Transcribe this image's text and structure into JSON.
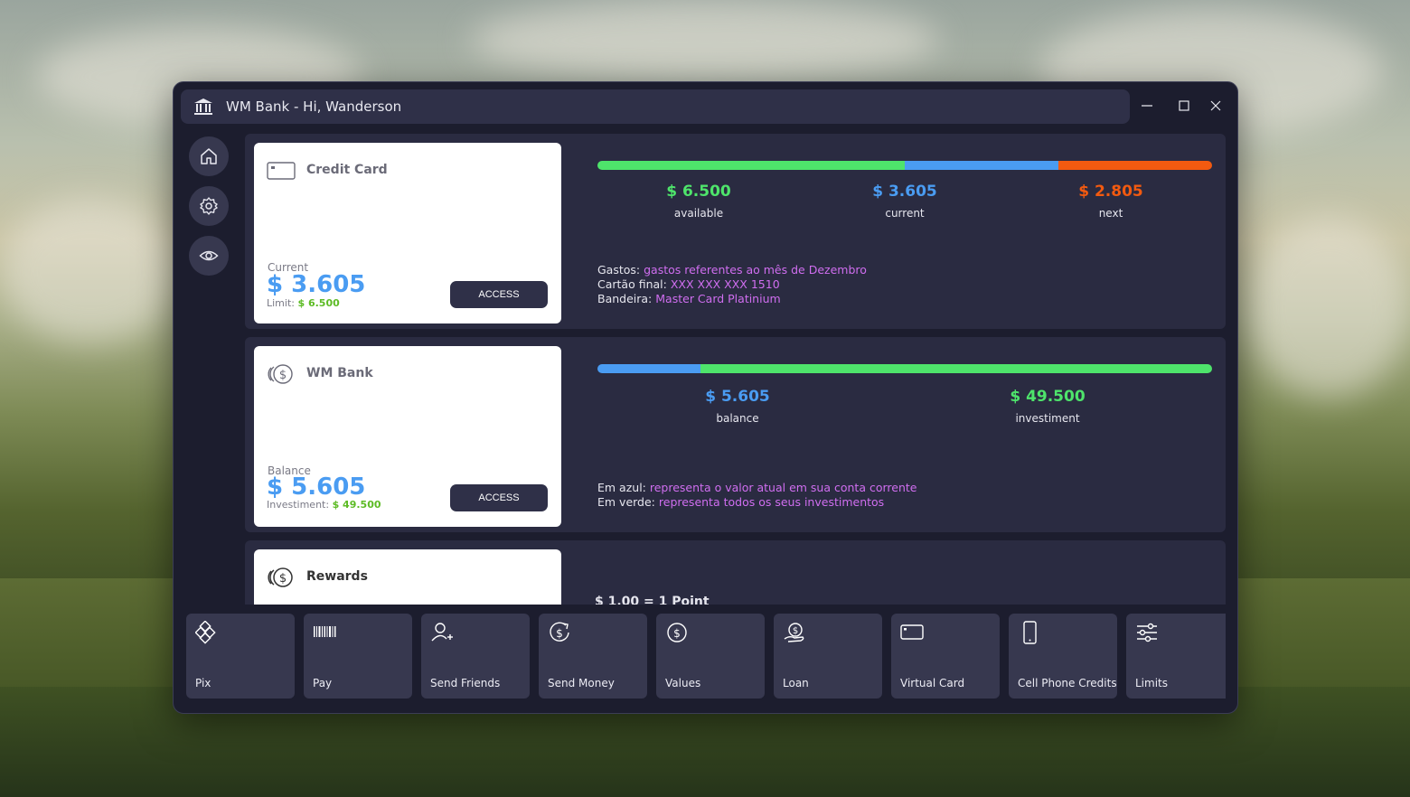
{
  "window": {
    "title": "WM Bank - Hi, Wanderson"
  },
  "sidebar": {
    "items": [
      {
        "name": "home",
        "icon": "home-icon"
      },
      {
        "name": "settings",
        "icon": "gear-icon"
      },
      {
        "name": "visibility",
        "icon": "eye-icon"
      }
    ]
  },
  "credit_card": {
    "title": "Credit Card",
    "current_label": "Current",
    "current_value": "$ 3.605",
    "limit_label": "Limit:",
    "limit_value": "$ 6.500",
    "access_label": "ACCESS",
    "bar": [
      {
        "fraction": 0.5,
        "color": "#4ee46b"
      },
      {
        "fraction": 0.25,
        "color": "#4a9cf2"
      },
      {
        "fraction": 0.25,
        "color": "#f25a10"
      }
    ],
    "stats": [
      {
        "value": "$ 6.500",
        "label": "available",
        "color": "#4ee46b"
      },
      {
        "value": "$ 3.605",
        "label": "current",
        "color": "#4a9cf2"
      },
      {
        "value": "$ 2.805",
        "label": "next",
        "color": "#f25a10"
      }
    ],
    "info": [
      {
        "key": "Gastos:",
        "value": "gastos referentes ao mês de Dezembro"
      },
      {
        "key": "Cartão final:",
        "value": "XXX XXX XXX 1510"
      },
      {
        "key": "Bandeira:",
        "value": "Master Card Platinium"
      }
    ]
  },
  "bank": {
    "title": "WM Bank",
    "balance_label": "Balance",
    "balance_value": "$ 5.605",
    "investment_label": "Investiment:",
    "investment_value": "$ 49.500",
    "access_label": "ACCESS",
    "bar": [
      {
        "fraction": 0.168,
        "color": "#4a9cf2"
      },
      {
        "fraction": 0.832,
        "color": "#4ee46b"
      }
    ],
    "stats": [
      {
        "value": "$ 5.605",
        "label": "balance",
        "color": "#4a9cf2"
      },
      {
        "value": "$ 49.500",
        "label": "investiment",
        "color": "#4ee46b"
      }
    ],
    "info": [
      {
        "key": "Em azul:",
        "value": "representa o valor atual em sua conta corrente"
      },
      {
        "key": "Em verde:",
        "value": "representa todos os seus investimentos"
      }
    ]
  },
  "rewards": {
    "title": "Rewards",
    "partial_text": "$ 1,00 = 1 Point"
  },
  "actions": [
    {
      "label": "Pix",
      "icon": "pix-icon"
    },
    {
      "label": "Pay",
      "icon": "barcode-icon"
    },
    {
      "label": "Send Friends",
      "icon": "add-user-icon"
    },
    {
      "label": "Send Money",
      "icon": "send-money-icon"
    },
    {
      "label": "Values",
      "icon": "values-icon"
    },
    {
      "label": "Loan",
      "icon": "loan-icon"
    },
    {
      "label": "Virtual Card",
      "icon": "card-icon"
    },
    {
      "label": "Cell Phone Credits",
      "icon": "phone-icon"
    },
    {
      "label": "Limits",
      "icon": "sliders-icon"
    }
  ]
}
